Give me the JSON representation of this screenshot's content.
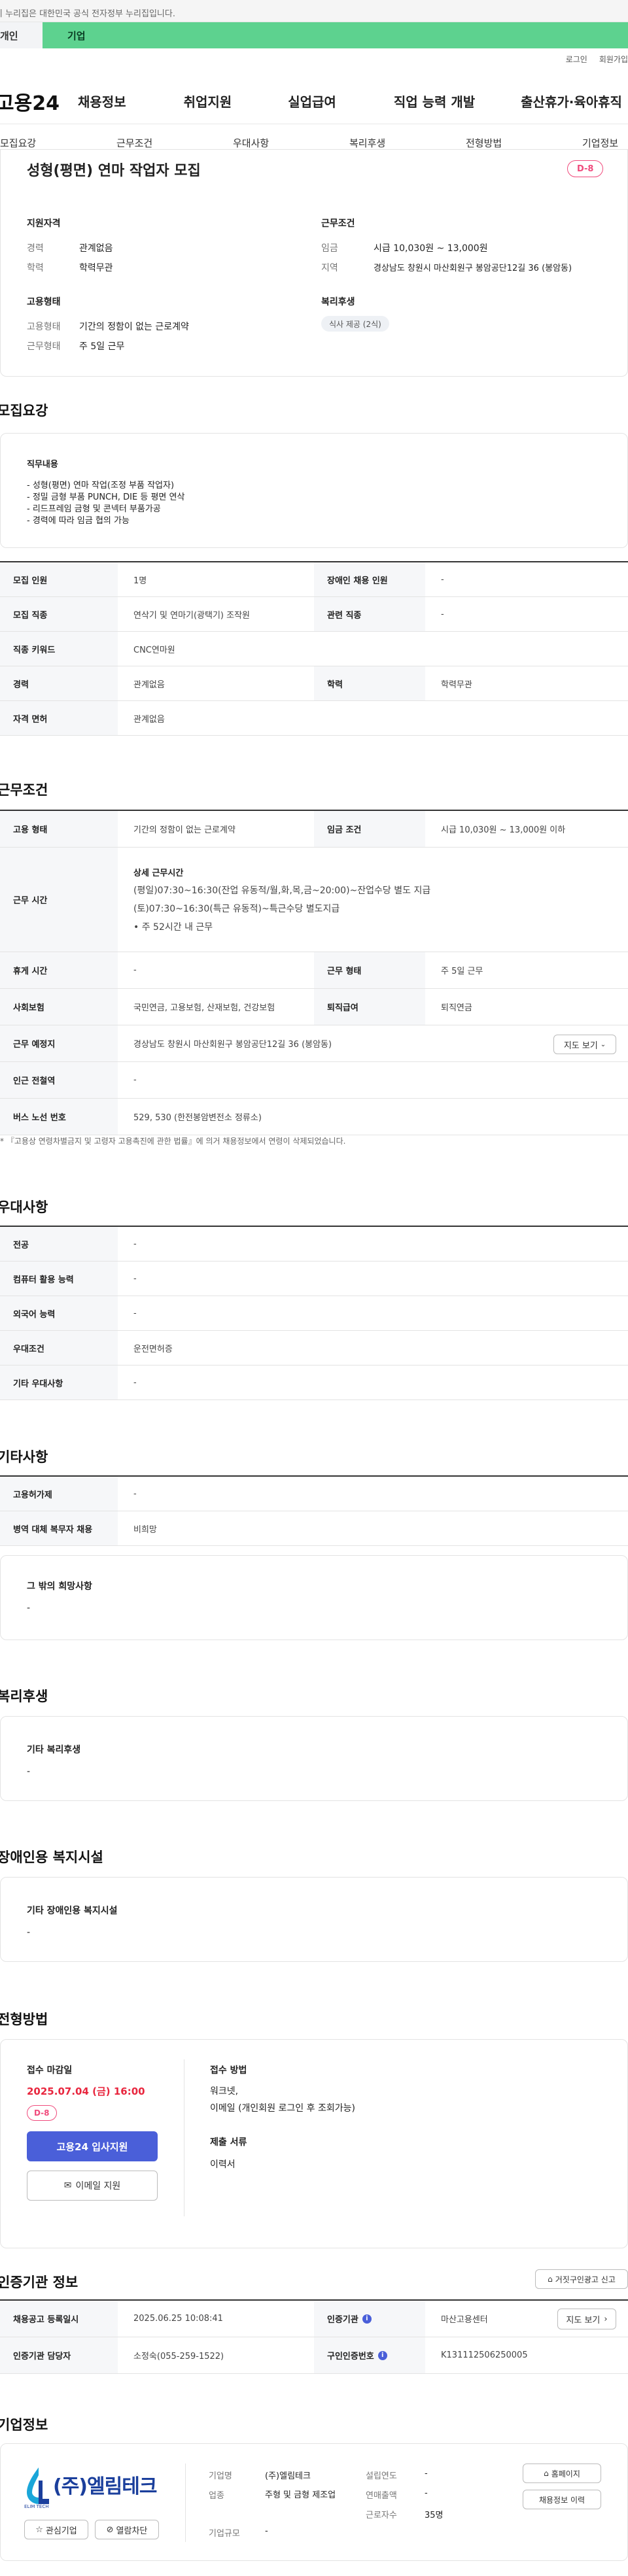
{
  "gov_banner": "이 누리집은 대한민국 공식 전자정부 누리집입니다.",
  "top_tabs": [
    {
      "label": "개인"
    },
    {
      "label": "기업"
    }
  ],
  "util_links": [
    "로그인",
    "회원가입"
  ],
  "logo_text": "고용24",
  "gnb": [
    "채용정보",
    "취업지원",
    "실업급여",
    "직업 능력 개발",
    "출산휴가·육아휴직"
  ],
  "snb": [
    "모집요강",
    "근무조건",
    "우대사항",
    "복리후생",
    "전형방법",
    "기업정보"
  ],
  "summary": {
    "title": "성형(평면) 연마 작업자 모집",
    "dday": "D-8",
    "qual_heading": "지원자격",
    "qual": [
      {
        "label": "경력",
        "value": "관계없음"
      },
      {
        "label": "학력",
        "value": "학력무관"
      }
    ],
    "emp_heading": "고용형태",
    "emp": [
      {
        "label": "고용형태",
        "value": "기간의 정함이 없는 근로계약"
      },
      {
        "label": "근무형태",
        "value": "주 5일 근무"
      }
    ],
    "cond_heading": "근무조건",
    "cond": [
      {
        "label": "임금",
        "value": "시급 10,030원 ~ 13,000원"
      },
      {
        "label": "지역",
        "value": "경상남도 창원시 마산회원구 봉암공단12길 36 (봉암동)"
      }
    ],
    "welfare_heading": "복리후생",
    "welfare_chip": "식사 제공 (2식)"
  },
  "recruit": {
    "title": "모집요강",
    "duty_heading": "직무내용",
    "duty_lines": [
      "- 성형(평면) 연마 작업(조정 부품 작업자)",
      "- 정밀 금형 부품 PUNCH, DIE 등 평면 연삭",
      "- 리드프레임 금형 및 콘넥터 부품가공",
      "- 경력에 따라 임금 협의 가능"
    ],
    "rows": [
      {
        "th1": "모집 인원",
        "td1": "1명",
        "th2": "장애인 채용 인원",
        "td2": "-"
      },
      {
        "th1": "모집 직종",
        "td1": "연삭기 및 연마기(광택기) 조작원",
        "th2": "관련 직종",
        "td2": "-"
      },
      {
        "th1": "직종 키워드",
        "td1": "CNC연마원"
      },
      {
        "th1": "경력",
        "td1": "관계없음",
        "th2": "학력",
        "td2": "학력무관"
      },
      {
        "th1": "자격 면허",
        "td1": "관계없음"
      }
    ]
  },
  "work": {
    "title": "근무조건",
    "row1": {
      "th1": "고용 형태",
      "td1": "기간의 정함이 없는 근로계약",
      "th2": "임금 조건",
      "td2": "시급 10,030원 ~ 13,000원 이하"
    },
    "hours_th": "근무 시간",
    "hours_heading": "상세 근무시간",
    "hours_lines": [
      "(평일)07:30~16:30(잔업 유동적/월,화,목,금~20:00)~잔업수당 별도 지급",
      "(토)07:30~16:30(특근 유동적)~특근수당 별도지급",
      "• 주 52시간 내 근무"
    ],
    "row3": {
      "th1": "휴게 시간",
      "td1": "-",
      "th2": "근무 형태",
      "td2": "주 5일 근무"
    },
    "row4": {
      "th1": "사회보험",
      "td1": "국민연금, 고용보험, 산재보험, 건강보험",
      "th2": "퇴직급여",
      "td2": "퇴직연금"
    },
    "row5": {
      "th1": "근무 예정지",
      "td1": "경상남도 창원시 마산회원구 봉암공단12길 36 (봉암동)",
      "btn": "지도 보기"
    },
    "row6": {
      "th1": "인근 전철역",
      "td1": "-"
    },
    "row7": {
      "th1": "버스 노선 번호",
      "td1": "529, 530 (한전봉암변전소 정류소)"
    },
    "note": "* 『고용상 연령차별금지 및 고령자 고용촉진에 관한 법률』에 의거 채용정보에서 연령이 삭제되었습니다."
  },
  "pref": {
    "title": "우대사항",
    "rows": [
      {
        "th": "전공",
        "td": "-"
      },
      {
        "th": "컴퓨터 활용 능력",
        "td": "-"
      },
      {
        "th": "외국어 능력",
        "td": "-"
      },
      {
        "th": "우대조건",
        "td": "운전면허증"
      },
      {
        "th": "기타 우대사항",
        "td": "-"
      }
    ]
  },
  "etc": {
    "title": "기타사항",
    "rows": [
      {
        "th": "고용허가제",
        "td": "-"
      },
      {
        "th": "병역 대체 복무자 채용",
        "td": "비희망"
      }
    ],
    "card_heading": "그 밖의 희망사항",
    "card_value": "-"
  },
  "welfare": {
    "title": "복리후생",
    "card_heading": "기타 복리후생",
    "card_value": "-"
  },
  "disabled": {
    "title": "장애인용 복지시설",
    "card_heading": "기타 장애인용 복지시설",
    "card_value": "-"
  },
  "selection": {
    "title": "전형방법",
    "deadline_heading": "접수 마감일",
    "deadline": "2025.07.04 (금) 16:00",
    "dday": "D-8",
    "apply_btn": "고용24 입사지원",
    "email_btn": "이메일 지원",
    "method_heading": "접수 방법",
    "method_lines": [
      "워크넷,",
      "이메일 (개인회원 로그인 후 조회가능)"
    ],
    "docs_heading": "제출 서류",
    "docs": "이력서"
  },
  "cert": {
    "title": "인증기관 정보",
    "report_btn": "거짓구인광고 신고",
    "rows": [
      {
        "th1": "채용공고 등록일시",
        "td1": "2025.06.25 10:08:41",
        "th2": "인증기관",
        "td2": "마산고용센터",
        "btn": "지도 보기"
      },
      {
        "th1": "인증기관 담당자",
        "td1": "소정숙(055-259-1522)",
        "th2": "구인인증번호",
        "td2": "K131112506250005"
      }
    ]
  },
  "company": {
    "title": "기업정보",
    "logo_text": "(주)엘림테크",
    "logo_sub": "ELIM TECH",
    "interest_btn": "관심기업",
    "block_btn": "열람차단",
    "fields": [
      {
        "label": "기업명",
        "value": "(주)엘림테크"
      },
      {
        "label": "업종",
        "value": "주형 및 금형 제조업"
      },
      {
        "label": "기업규모",
        "value": "-"
      }
    ],
    "fields2": [
      {
        "label": "설립연도",
        "value": "-"
      },
      {
        "label": "연매출액",
        "value": "-"
      },
      {
        "label": "근로자수",
        "value": "35명"
      }
    ],
    "home_btn": "홈페이지",
    "history_btn": "채용정보 이력"
  },
  "colors": {
    "accent": "#4a5fd9",
    "dday": "#f04a7c",
    "green_tab": "#5dd28f",
    "deadline": "#e8263e"
  }
}
